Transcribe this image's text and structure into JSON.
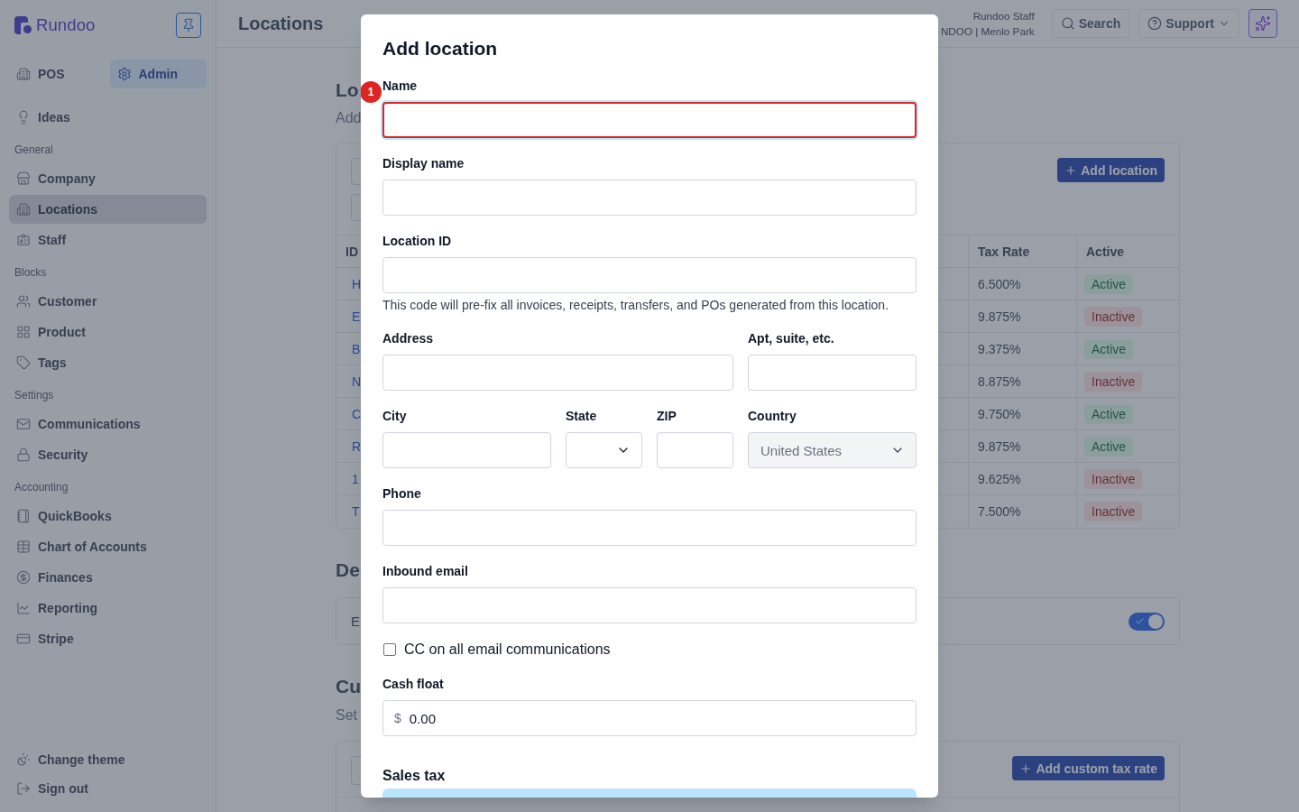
{
  "sidebar": {
    "brand": "Rundoo",
    "modes": [
      {
        "label": "POS",
        "selected": false
      },
      {
        "label": "Admin",
        "selected": true
      }
    ],
    "top_items": [
      {
        "label": "Ideas",
        "selected": false
      }
    ],
    "sections": [
      {
        "title": "General",
        "items": [
          {
            "label": "Company",
            "selected": false
          },
          {
            "label": "Locations",
            "selected": true
          },
          {
            "label": "Staff",
            "selected": false
          }
        ]
      },
      {
        "title": "Blocks",
        "items": [
          {
            "label": "Customer",
            "selected": false
          },
          {
            "label": "Product",
            "selected": false
          },
          {
            "label": "Tags",
            "selected": false
          }
        ]
      },
      {
        "title": "Settings",
        "items": [
          {
            "label": "Communications",
            "selected": false
          },
          {
            "label": "Security",
            "selected": false
          }
        ]
      },
      {
        "title": "Accounting",
        "items": [
          {
            "label": "QuickBooks",
            "selected": false
          },
          {
            "label": "Chart of Accounts",
            "selected": false
          },
          {
            "label": "Finances",
            "selected": false
          },
          {
            "label": "Reporting",
            "selected": false
          },
          {
            "label": "Stripe",
            "selected": false
          }
        ]
      }
    ],
    "footer_items": [
      {
        "label": "Change theme"
      },
      {
        "label": "Sign out"
      }
    ]
  },
  "header": {
    "title": "Locations",
    "user_name": "Rundoo Staff",
    "user_org": "NDOO | Menlo Park",
    "search_button": "Search",
    "support_button": "Support"
  },
  "page": {
    "locations": {
      "heading": "Lo",
      "subtitle": "Add",
      "add_button": "Add location",
      "columns": [
        "ID",
        "Tax Rate",
        "Active"
      ],
      "rows": [
        {
          "id": "H",
          "tax_rate": "6.500%",
          "status": "Active",
          "active": true
        },
        {
          "id": "E",
          "tax_rate": "9.875%",
          "status": "Inactive",
          "active": false
        },
        {
          "id": "B",
          "tax_rate": "9.375%",
          "status": "Active",
          "active": true
        },
        {
          "id": "N",
          "tax_rate": "8.875%",
          "status": "Inactive",
          "active": false
        },
        {
          "id": "C",
          "tax_rate": "9.750%",
          "status": "Active",
          "active": true
        },
        {
          "id": "R",
          "tax_rate": "9.875%",
          "status": "Active",
          "active": true
        },
        {
          "id": "1",
          "tax_rate": "9.625%",
          "status": "Inactive",
          "active": false
        },
        {
          "id": "T",
          "tax_rate": "7.500%",
          "status": "Inactive",
          "active": false
        }
      ]
    },
    "default_section": {
      "heading": "De",
      "setting_label": "E",
      "toggle_on": true
    },
    "custom_tax": {
      "heading": "Cu",
      "subtitle": "Set",
      "add_button": "Add custom tax rate"
    }
  },
  "dialog": {
    "title": "Add location",
    "rows": [
      {
        "fields": [
          {
            "kind": "text",
            "label": "Name",
            "badge": "1",
            "focused": true,
            "error": true,
            "disabled": false
          }
        ]
      },
      {
        "fields": [
          {
            "kind": "text",
            "label": "Display name",
            "focused": false,
            "error": false,
            "disabled": false
          }
        ]
      },
      {
        "fields": [
          {
            "kind": "text",
            "label": "Location ID",
            "help": "This code will pre-fix all invoices, receipts, transfers, and POs generated from this location.",
            "focused": false,
            "error": false,
            "disabled": false
          }
        ]
      },
      {
        "fields": [
          {
            "kind": "text",
            "label": "Address",
            "focused": false,
            "error": false,
            "disabled": false
          },
          {
            "kind": "text",
            "label": "Apt, suite, etc.",
            "focused": false,
            "error": false,
            "disabled": false
          }
        ]
      },
      {
        "fields": [
          {
            "kind": "text",
            "label": "City",
            "focused": false,
            "error": false,
            "disabled": false
          },
          {
            "kind": "select",
            "label": "State",
            "disabled": false
          },
          {
            "kind": "text",
            "label": "ZIP",
            "focused": false,
            "error": false,
            "disabled": false
          },
          {
            "kind": "select",
            "label": "Country",
            "value": "United States",
            "disabled": true
          }
        ]
      },
      {
        "fields": [
          {
            "kind": "text",
            "label": "Phone",
            "focused": false,
            "error": false,
            "disabled": false
          }
        ]
      },
      {
        "fields": [
          {
            "kind": "text",
            "label": "Inbound email",
            "focused": false,
            "error": false,
            "disabled": false
          }
        ]
      },
      {
        "fields": [
          {
            "kind": "checkbox",
            "label": "CC on all email communications",
            "checked": false
          }
        ]
      },
      {
        "fields": [
          {
            "kind": "currency",
            "label": "Cash float",
            "prefix": "$",
            "value": "0.00",
            "focused": false,
            "error": false,
            "disabled": false
          }
        ]
      }
    ],
    "section_heading": "Sales tax"
  }
}
